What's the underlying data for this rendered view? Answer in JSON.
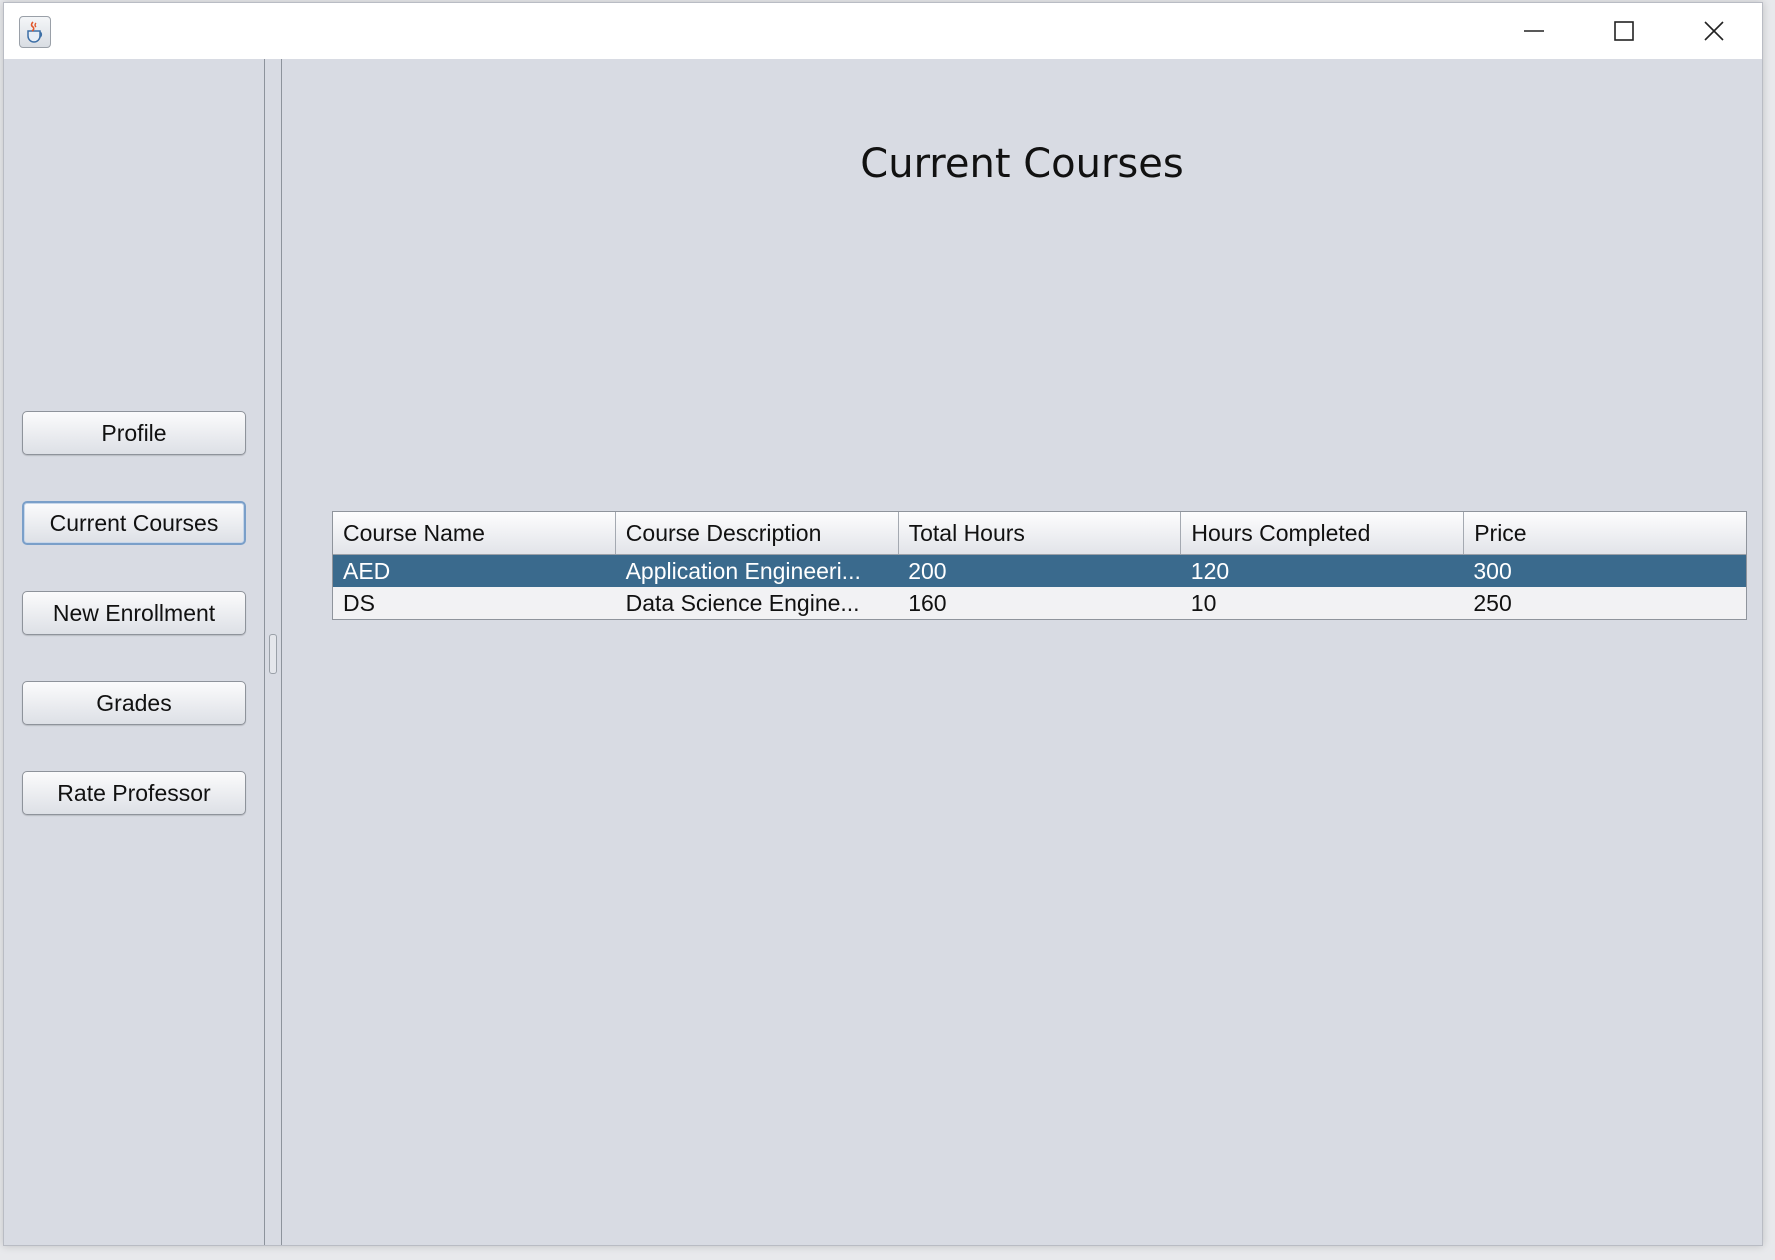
{
  "titlebar": {
    "app_icon": "java-coffee-cup-icon",
    "controls": [
      "minimize-icon",
      "maximize-icon",
      "close-icon"
    ]
  },
  "sidebar": {
    "buttons": [
      {
        "label": "Profile"
      },
      {
        "label": "Current Courses",
        "active": true
      },
      {
        "label": "New Enrollment"
      },
      {
        "label": "Grades"
      },
      {
        "label": "Rate Professor"
      }
    ]
  },
  "main": {
    "title": "Current Courses",
    "table": {
      "columns": [
        "Course Name",
        "Course Description",
        "Total Hours",
        "Hours Completed",
        "Price"
      ],
      "rows": [
        {
          "cells": [
            "AED",
            "Application Engineeri...",
            "200",
            "120",
            "300"
          ],
          "selected": true
        },
        {
          "cells": [
            "DS",
            "Data Science Engine...",
            "160",
            "10",
            "250"
          ],
          "selected": false
        }
      ]
    }
  },
  "colors": {
    "selection": "#3a6a8d",
    "panel_bg": "#d8dbe3"
  }
}
